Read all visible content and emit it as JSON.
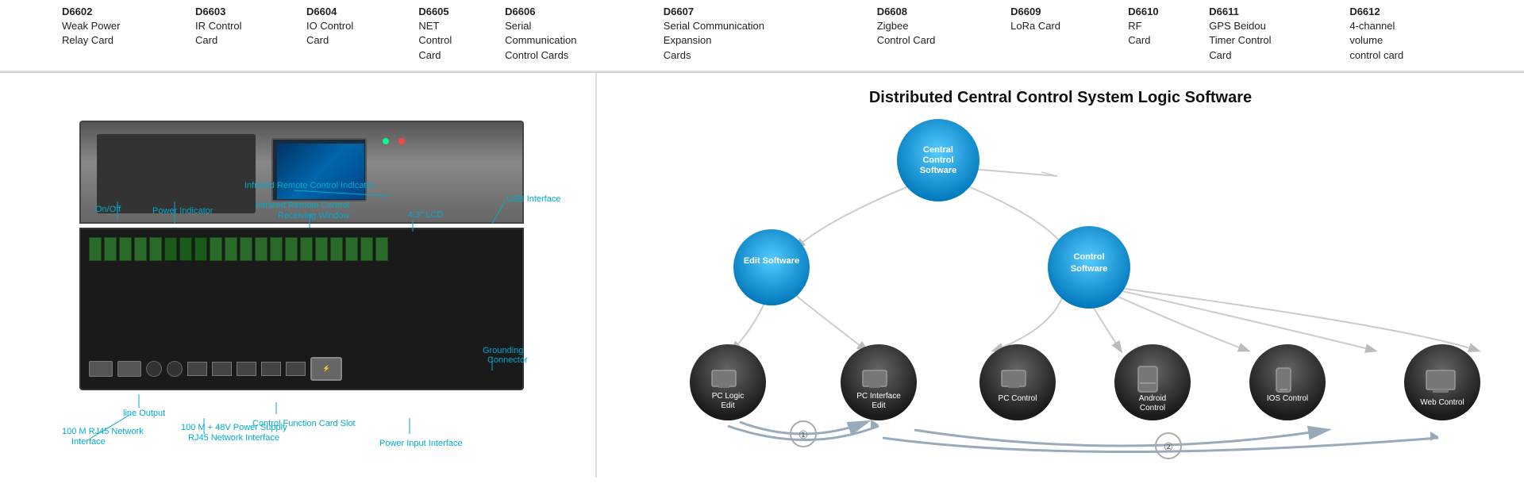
{
  "topTable": {
    "columns": [
      {
        "id": "D6602",
        "name": "D6602",
        "desc": "Weak Power Relay Card"
      },
      {
        "id": "D6603",
        "name": "D6603",
        "desc": "IR Control Card"
      },
      {
        "id": "D6604",
        "name": "D6604",
        "desc": "IO Control Card"
      },
      {
        "id": "D6605",
        "name": "D6605",
        "desc": "NET Control Card"
      },
      {
        "id": "D6606",
        "name": "D6606",
        "desc": "Serial Communication Control Cards"
      },
      {
        "id": "D6607",
        "name": "D6607",
        "desc": "Serial Communication Expansion Cards"
      },
      {
        "id": "D6608",
        "name": "D6608",
        "desc": "Zigbee Control Card"
      },
      {
        "id": "D6609",
        "name": "D6609",
        "desc": "LoRa Card"
      },
      {
        "id": "D6610",
        "name": "D6610",
        "desc": "RF Card"
      },
      {
        "id": "D6611",
        "name": "D6611",
        "desc": "GPS Beidou Timer Control Card"
      },
      {
        "id": "D6612",
        "name": "D6612",
        "desc": "4-channel volume control card"
      }
    ]
  },
  "leftDiagram": {
    "labels": {
      "onOff": "On/Off",
      "powerIndicator": "Power Indicator",
      "infraredIndicator": "Infrared Remote Control Indicator",
      "infraredWindow": "Infrared Remote Control\nReceiving Window",
      "lcd": "4.3\" LCD",
      "usbInterface": "USB Interface",
      "lineOutput": "line Output",
      "network100m": "100 M RJ45 Network\nInterface",
      "network100mPlus": "100 M + 48V Power Supply\nRJ45 Network Interface",
      "controlSlot": "Control Function Card Slot",
      "powerInput": "Power Input Interface",
      "grounding": "Grounding\nConnector"
    }
  },
  "rightDiagram": {
    "title": "Distributed Central Control System Logic Software",
    "nodes": {
      "centralControl": "Central\nControl\nSoftware",
      "editSoftware": "Edit Software",
      "controlSoftware": "Control\nSoftware",
      "pcLogicEdit": "PC Logic\nEdit",
      "pcInterfaceEdit": "PC Interface\nEdit",
      "pcControl": "PC Control",
      "androidControl": "Android\nControl",
      "iosControl": "IOS Control",
      "webControl": "Web Control"
    },
    "numbers": [
      "①",
      "②"
    ]
  }
}
